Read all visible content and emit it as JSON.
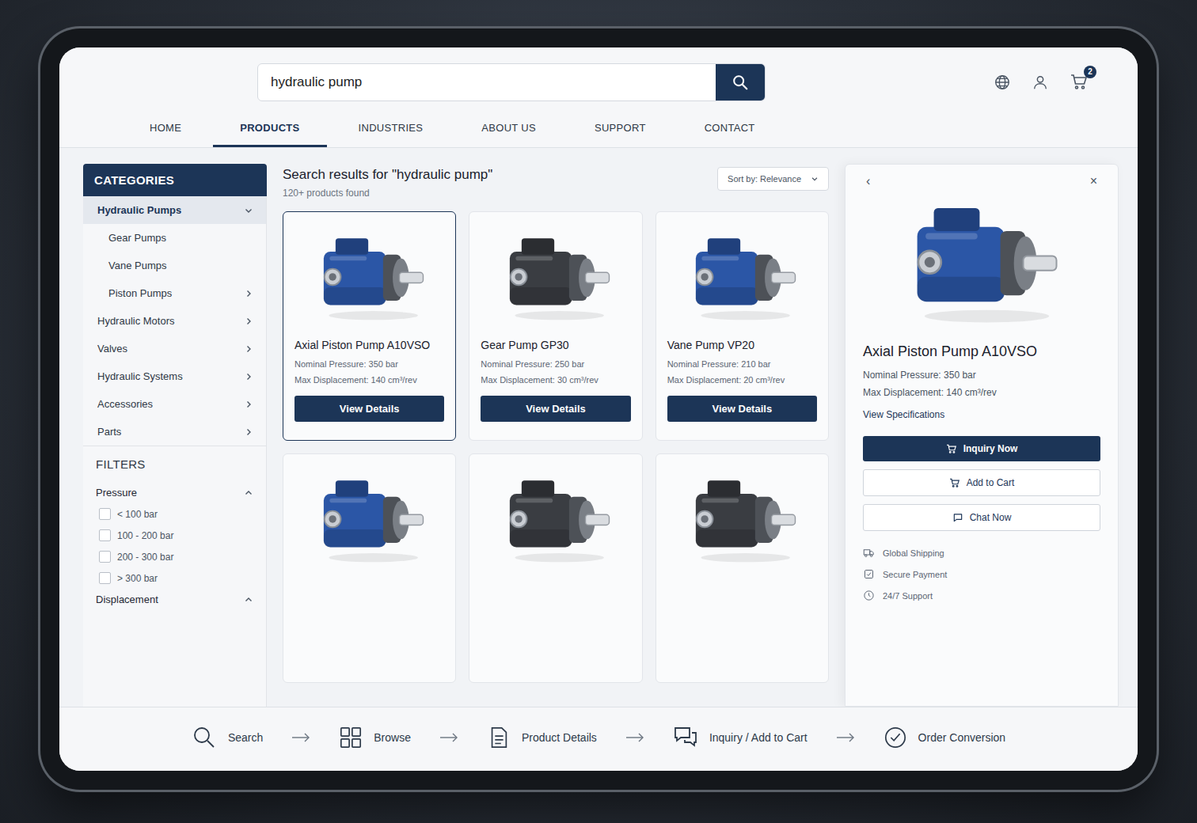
{
  "search": {
    "value": "hydraulic pump"
  },
  "cart": {
    "badge": "2"
  },
  "nav": [
    {
      "label": "HOME",
      "selected": false
    },
    {
      "label": "PRODUCTS",
      "selected": true
    },
    {
      "label": "INDUSTRIES",
      "selected": false
    },
    {
      "label": "ABOUT US",
      "selected": false
    },
    {
      "label": "SUPPORT",
      "selected": false
    },
    {
      "label": "CONTACT",
      "selected": false
    }
  ],
  "sidebar": {
    "title": "CATEGORIES",
    "items": [
      {
        "label": "Hydraulic Pumps",
        "kind": "group",
        "selected": true,
        "has_children": true,
        "expanded": true
      },
      {
        "label": "Gear Pumps",
        "kind": "sub",
        "selected": false,
        "has_children": false,
        "expanded": false
      },
      {
        "label": "Vane Pumps",
        "kind": "sub",
        "selected": false,
        "has_children": false,
        "expanded": false
      },
      {
        "label": "Piston Pumps",
        "kind": "sub",
        "selected": false,
        "has_children": true,
        "expanded": false
      },
      {
        "label": "Hydraulic Motors",
        "kind": "group",
        "selected": false,
        "has_children": true,
        "expanded": false
      },
      {
        "label": "Valves",
        "kind": "group",
        "selected": false,
        "has_children": true,
        "expanded": false
      },
      {
        "label": "Hydraulic Systems",
        "kind": "group",
        "selected": false,
        "has_children": true,
        "expanded": false
      },
      {
        "label": "Accessories",
        "kind": "group",
        "selected": false,
        "has_children": true,
        "expanded": false
      },
      {
        "label": "Parts",
        "kind": "group",
        "selected": false,
        "has_children": true,
        "expanded": false
      }
    ]
  },
  "filters": {
    "title": "FILTERS",
    "groups": [
      {
        "label": "Pressure",
        "expanded": true,
        "options": [
          {
            "label": "< 100 bar",
            "checked": false
          },
          {
            "label": "100 - 200 bar",
            "checked": false
          },
          {
            "label": "200 - 300 bar",
            "checked": false
          },
          {
            "label": "> 300 bar",
            "checked": false
          }
        ]
      },
      {
        "label": "Displacement",
        "expanded": true,
        "options": []
      }
    ]
  },
  "results": {
    "title": "Search results for \"hydraulic pump\"",
    "count": "120+ products found",
    "sort": "Sort by: Relevance",
    "products": [
      {
        "kind": "full",
        "name": "Axial Piston Pump A10VSO",
        "pressure": "Nominal Pressure: 350 bar",
        "displacement": "Max Displacement: 140 cm³/rev",
        "button": "View Details",
        "selected": true,
        "color": "#2b56a6"
      },
      {
        "kind": "full",
        "name": "Gear Pump GP30",
        "pressure": "Nominal Pressure: 250 bar",
        "displacement": "Max Displacement: 30 cm³/rev",
        "button": "View Details",
        "selected": false,
        "color": "#3a3d42"
      },
      {
        "kind": "full",
        "name": "Vane Pump VP20",
        "pressure": "Nominal Pressure: 210 bar",
        "displacement": "Max Displacement: 20 cm³/rev",
        "button": "View Details",
        "selected": false,
        "color": "#2b56a6"
      },
      {
        "kind": "cut",
        "name": "",
        "pressure": "",
        "displacement": "",
        "button": "",
        "selected": false,
        "color": "#2b56a6"
      },
      {
        "kind": "cut",
        "name": "",
        "pressure": "",
        "displacement": "",
        "button": "",
        "selected": false,
        "color": "#3a3d42"
      },
      {
        "kind": "cut",
        "name": "",
        "pressure": "",
        "displacement": "",
        "button": "",
        "selected": false,
        "color": "#3a3d42"
      }
    ]
  },
  "detail": {
    "back": "‹",
    "close": "×",
    "color": "#2b56a6",
    "name": "Axial Piston Pump A10VSO",
    "pressure": "Nominal Pressure: 350 bar",
    "displacement": "Max Displacement: 140 cm³/rev",
    "specs_link": "View Specifications",
    "primary": "Inquiry Now",
    "secondary": [
      "Add to Cart",
      "Chat Now"
    ],
    "features": [
      "Global Shipping",
      "Secure Payment",
      "24/7 Support"
    ]
  },
  "flow": [
    "Search",
    "Browse",
    "Product Details",
    "Inquiry / Add to Cart",
    "Order Conversion"
  ]
}
